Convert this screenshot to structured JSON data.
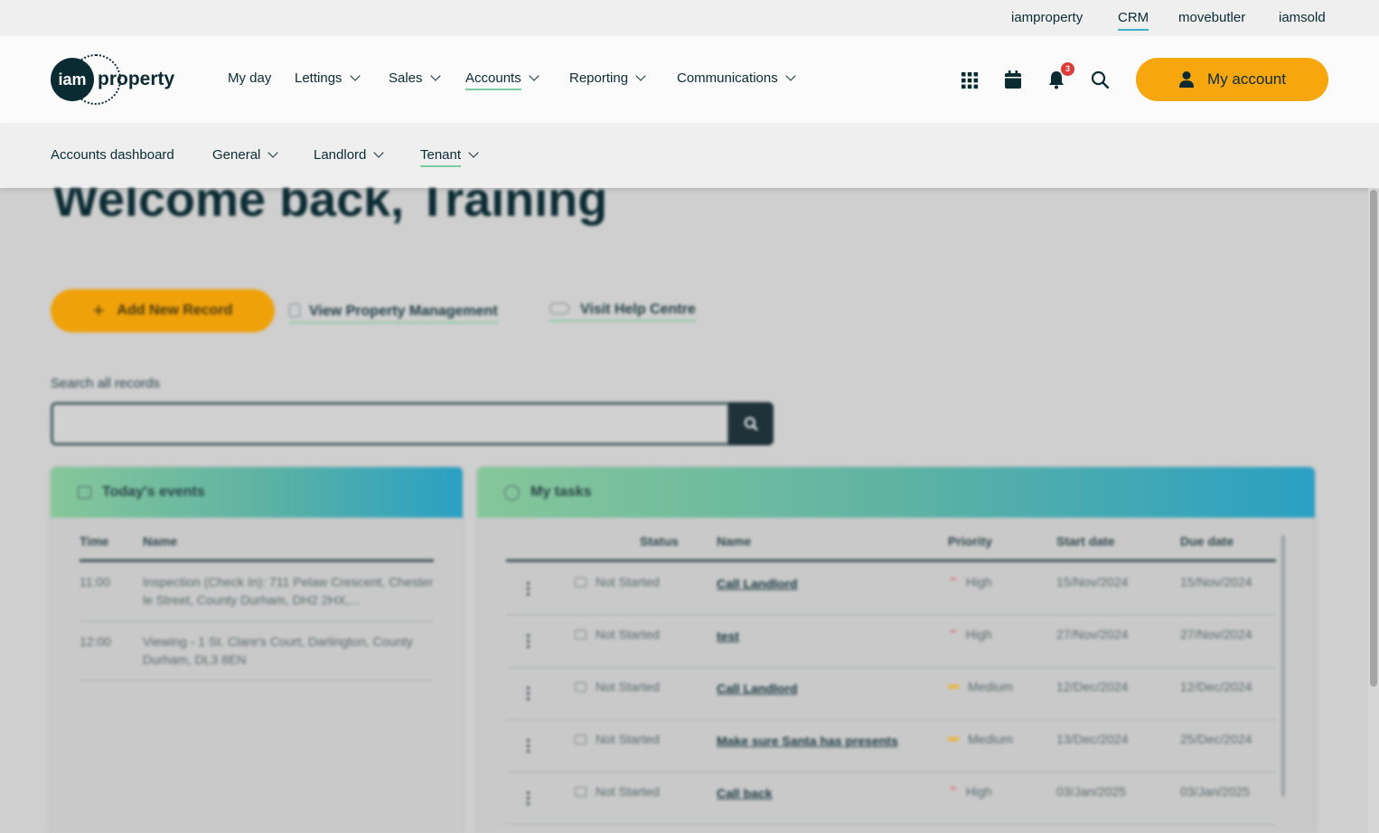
{
  "top_links": [
    "iamproperty",
    "CRM",
    "movebutler",
    "iamsold"
  ],
  "top_active": "CRM",
  "logo": {
    "circle": "iam",
    "text": "property"
  },
  "nav": [
    {
      "label": "My day",
      "dropdown": false
    },
    {
      "label": "Lettings",
      "dropdown": true
    },
    {
      "label": "Sales",
      "dropdown": true
    },
    {
      "label": "Accounts",
      "dropdown": true,
      "active": true
    },
    {
      "label": "Reporting",
      "dropdown": true
    },
    {
      "label": "Communications",
      "dropdown": true
    }
  ],
  "header_icons": {
    "apps": "grid-icon",
    "calendar": "calendar-icon",
    "notifications": "bell-icon",
    "notification_count": "3",
    "search": "search-icon"
  },
  "my_account_label": "My account",
  "subnav": [
    {
      "label": "Accounts dashboard",
      "dropdown": false
    },
    {
      "label": "General",
      "dropdown": true
    },
    {
      "label": "Landlord",
      "dropdown": true
    },
    {
      "label": "Tenant",
      "dropdown": true,
      "active": true
    }
  ],
  "welcome": "Welcome back, Training",
  "actions": {
    "add_new_record": "Add New Record",
    "view_property_management": "View Property Management",
    "visit_help_centre": "Visit Help Centre"
  },
  "search": {
    "label": "Search all records",
    "value": "",
    "placeholder": ""
  },
  "events": {
    "title": "Today's events",
    "headers": [
      "Time",
      "Name"
    ],
    "rows": [
      {
        "time": "11:00",
        "name": "Inspection (Check In): 711 Pelaw Crescent, Chester le Street, County Durham, DH2 2HX,..."
      },
      {
        "time": "12:00",
        "name": "Viewing - 1 St. Clare's Court, Darlington, County Durham, DL3 8EN"
      }
    ]
  },
  "tasks": {
    "title": "My tasks",
    "headers": [
      "Status",
      "Name",
      "Priority",
      "Start date",
      "Due date"
    ],
    "rows": [
      {
        "status": "Not Started",
        "name": "Call Landlord",
        "priority": "High",
        "start": "15/Nov/2024",
        "due": "15/Nov/2024"
      },
      {
        "status": "Not Started",
        "name": "test",
        "priority": "High",
        "start": "27/Nov/2024",
        "due": "27/Nov/2024"
      },
      {
        "status": "Not Started",
        "name": "Call Landlord",
        "priority": "Medium",
        "start": "12/Dec/2024",
        "due": "12/Dec/2024"
      },
      {
        "status": "Not Started",
        "name": "Make sure Santa has presents",
        "priority": "Medium",
        "start": "13/Dec/2024",
        "due": "25/Dec/2024"
      },
      {
        "status": "Not Started",
        "name": "Call back",
        "priority": "High",
        "start": "03/Jan/2025",
        "due": "03/Jan/2025"
      }
    ]
  },
  "colors": {
    "accent": "#f7a60d",
    "brand": "#0b2b33",
    "active_underline": "#7ccba0",
    "crm_underline": "#3bb0c9",
    "badge": "#e23a3a"
  }
}
